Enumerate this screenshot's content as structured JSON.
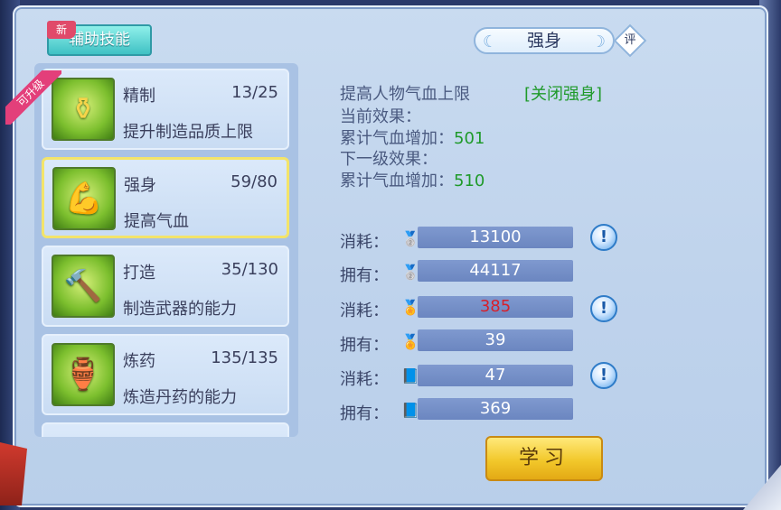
{
  "tab": {
    "label": "辅助技能",
    "new_badge": "新"
  },
  "skills": [
    {
      "name": "精制",
      "level": "13/25",
      "desc": "提升制造品质上限",
      "icon": "gourd-icon",
      "badge": "可升级"
    },
    {
      "name": "强身",
      "level": "59/80",
      "desc": "提高气血",
      "icon": "strongman-icon"
    },
    {
      "name": "打造",
      "level": "35/130",
      "desc": "制造武器的能力",
      "icon": "hammer-icon"
    },
    {
      "name": "炼药",
      "level": "135/135",
      "desc": "炼造丹药的能力",
      "icon": "cauldron-icon"
    }
  ],
  "detail": {
    "title": "强身",
    "eval_label": "评",
    "effect_desc": "提高人物气血上限",
    "close_link": "[关闭强身]",
    "current_label": "当前效果：",
    "current_stat_label": "累计气血增加：",
    "current_value": "501",
    "next_label": "下一级效果：",
    "next_stat_label": "累计气血增加：",
    "next_value": "510"
  },
  "costs": [
    {
      "label": "消耗：",
      "value": "13100",
      "icon": "silver-icon",
      "alert": true,
      "highlight": false
    },
    {
      "label": "拥有：",
      "value": "44117",
      "icon": "silver-icon",
      "alert": false,
      "highlight": false
    },
    {
      "label": "消耗：",
      "value": "385",
      "icon": "contribution-icon",
      "alert": true,
      "highlight": true
    },
    {
      "label": "拥有：",
      "value": "39",
      "icon": "contribution-icon",
      "alert": false,
      "highlight": false
    },
    {
      "label": "消耗：",
      "value": "47",
      "icon": "book-icon",
      "alert": true,
      "highlight": false
    },
    {
      "label": "拥有：",
      "value": "369",
      "icon": "book-icon",
      "alert": false,
      "highlight": false
    }
  ],
  "learn_button": "学习",
  "colors": {
    "accent_green": "#1f9a2a",
    "cost_red": "#d8202a",
    "button_gold": "#f2c82b",
    "tab_teal": "#3fc1c4"
  }
}
